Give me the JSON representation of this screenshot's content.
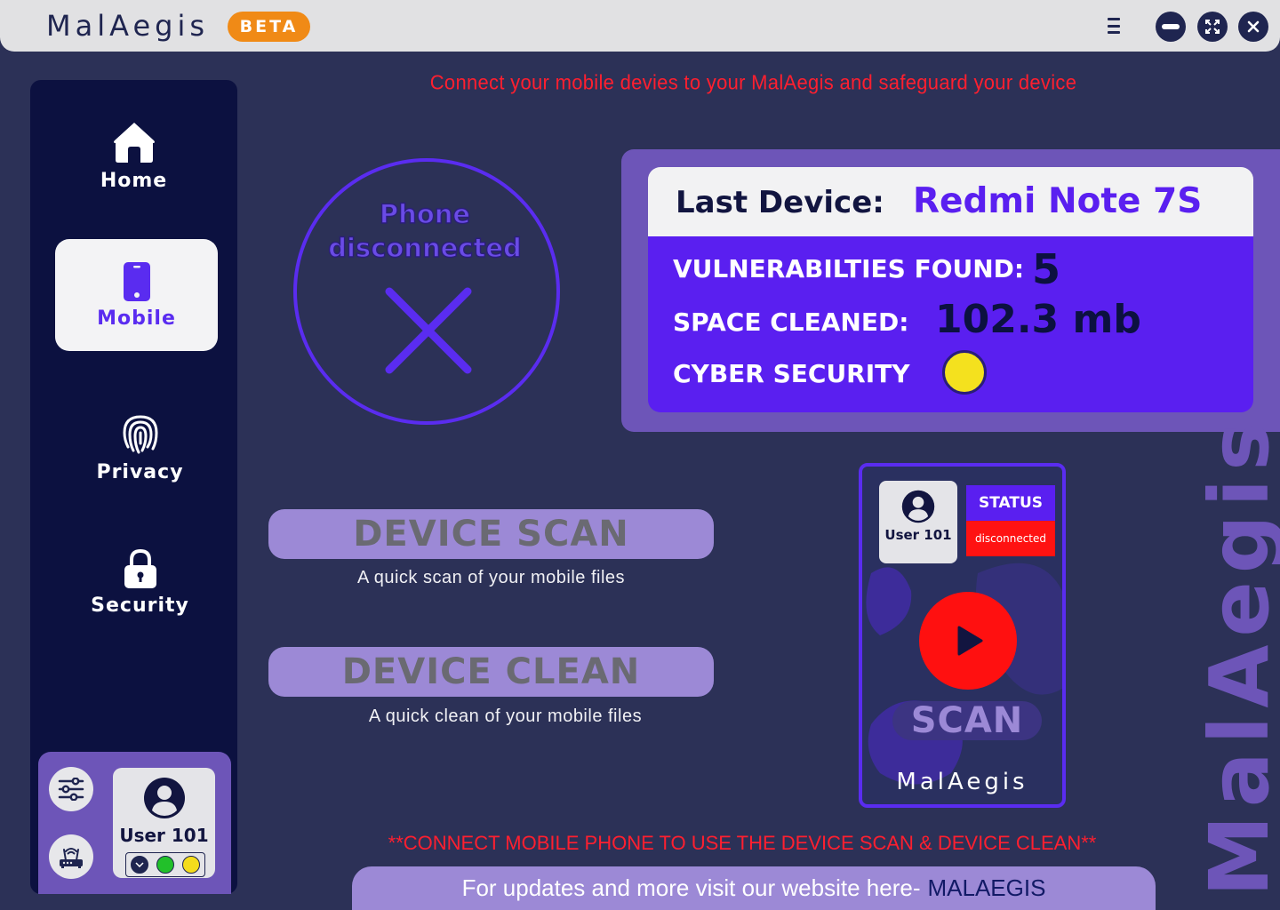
{
  "app": {
    "title": "MalAegis",
    "badge": "BETA"
  },
  "window_controls": {
    "menu": "menu-icon",
    "minimize": "minimize-icon",
    "maximize": "maximize-icon",
    "close": "close-icon"
  },
  "headline": "Connect your mobile devies to your MalAegis and safeguard your device",
  "sidebar": {
    "items": [
      {
        "label": "Home",
        "icon": "home-icon",
        "active": false
      },
      {
        "label": "Mobile",
        "icon": "mobile-icon",
        "active": true
      },
      {
        "label": "Privacy",
        "icon": "fingerprint-icon",
        "active": false
      },
      {
        "label": "Security",
        "icon": "lock-icon",
        "active": false
      }
    ],
    "user": {
      "name": "User 101",
      "status_colors": [
        "#1f2550",
        "#22c02a",
        "#f4dc1c"
      ]
    }
  },
  "phone": {
    "status_line1": "Phone",
    "status_line2": "disconnected"
  },
  "device": {
    "label": "Last Device:",
    "name": "Redmi Note 7S",
    "vuln_label": "VULNERABILTIES FOUND:",
    "vuln_value": "5",
    "space_label": "SPACE CLEANED:",
    "space_value": "102.3 mb",
    "security_label": "CYBER SECURITY",
    "security_color": "#f4e11e"
  },
  "actions": {
    "scan_label": "DEVICE SCAN",
    "scan_desc": "A quick scan of your mobile files",
    "clean_label": "DEVICE CLEAN",
    "clean_desc": "A quick clean of your mobile files"
  },
  "scan_widget": {
    "user": "User 101",
    "status_title": "STATUS",
    "status_value": "disconnected",
    "scan_label": "SCAN",
    "brand": "MalAegis"
  },
  "watermark": "MalAegis",
  "bottom_note": "**CONNECT MOBILE PHONE TO USE THE DEVICE SCAN & DEVICE CLEAN**",
  "footer": {
    "text": "For updates and more visit our website here-",
    "link": "MALAEGIS"
  },
  "colors": {
    "accent": "#5a1ff0",
    "lavender": "#6d55b8",
    "sidebar": "#0c1140",
    "background": "#2c3157",
    "alert": "#ff1f2f",
    "brand_orange": "#f08a16"
  }
}
